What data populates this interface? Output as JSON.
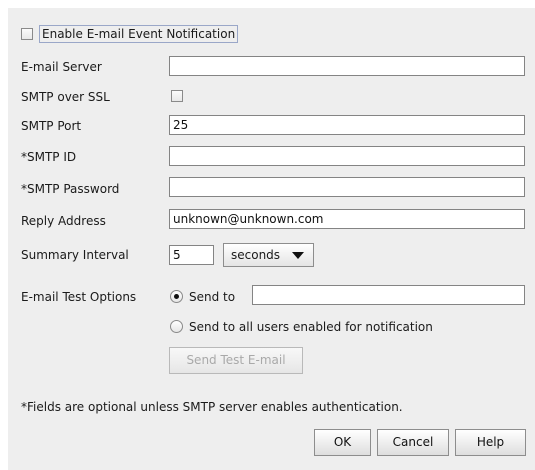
{
  "enable_notification": {
    "label": "Enable E-mail Event Notification",
    "checked": false
  },
  "form": {
    "email_server": {
      "label": "E-mail Server",
      "value": ""
    },
    "smtp_ssl": {
      "label": "SMTP over SSL",
      "checked": false
    },
    "smtp_port": {
      "label": "SMTP Port",
      "value": "25"
    },
    "smtp_id": {
      "label": "*SMTP ID",
      "value": ""
    },
    "smtp_password": {
      "label": "*SMTP Password",
      "value": ""
    },
    "reply_address": {
      "label": "Reply Address",
      "value": "unknown@unknown.com"
    },
    "summary_interval": {
      "label": "Summary Interval",
      "value": "5",
      "unit": "seconds"
    }
  },
  "test_options": {
    "label": "E-mail Test Options",
    "send_to_label": "Send to",
    "send_to_value": "",
    "send_to_selected": true,
    "send_all_label": "Send to all users enabled for notification",
    "send_all_selected": false,
    "send_test_button": "Send Test E-mail"
  },
  "note": "*Fields are optional unless SMTP server enables authentication.",
  "buttons": {
    "ok": "OK",
    "cancel": "Cancel",
    "help": "Help"
  }
}
